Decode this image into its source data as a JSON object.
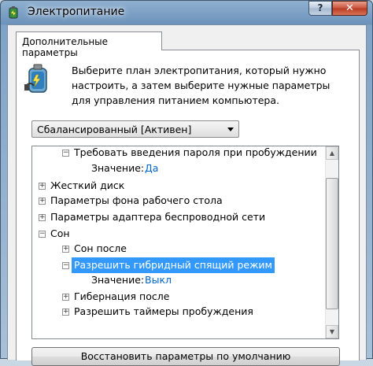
{
  "window": {
    "title": "Электропитание",
    "help_label": "?",
    "close_label": "✕"
  },
  "tab": {
    "label": "Дополнительные параметры"
  },
  "description": "Выберите план электропитания, который нужно настроить, а затем выберите нужные параметры для управления питанием компьютера.",
  "plan_select": {
    "value": "Сбалансированный [Активен]"
  },
  "tree": {
    "items": [
      {
        "expander": "minus",
        "label": "Требовать введения пароля при пробуждении"
      },
      {
        "label": "Значение:",
        "value": "Да"
      },
      {
        "expander": "plus",
        "label": "Жесткий диск"
      },
      {
        "expander": "plus",
        "label": "Параметры фона рабочего стола"
      },
      {
        "expander": "plus",
        "label": "Параметры адаптера беспроводной сети"
      },
      {
        "expander": "minus",
        "label": "Сон"
      },
      {
        "expander": "plus",
        "label": "Сон после"
      },
      {
        "expander": "minus",
        "label": "Разрешить гибридный спящий режим",
        "selected": true
      },
      {
        "label": "Значение:",
        "value": "Выкл"
      },
      {
        "expander": "plus",
        "label": "Гибернация после"
      },
      {
        "expander": "plus",
        "label": "Разрешить таймеры пробуждения"
      }
    ]
  },
  "restore_button": {
    "label": "Восстановить параметры по умолчанию"
  },
  "colors": {
    "selection": "#3399ff",
    "link": "#0066cc"
  }
}
